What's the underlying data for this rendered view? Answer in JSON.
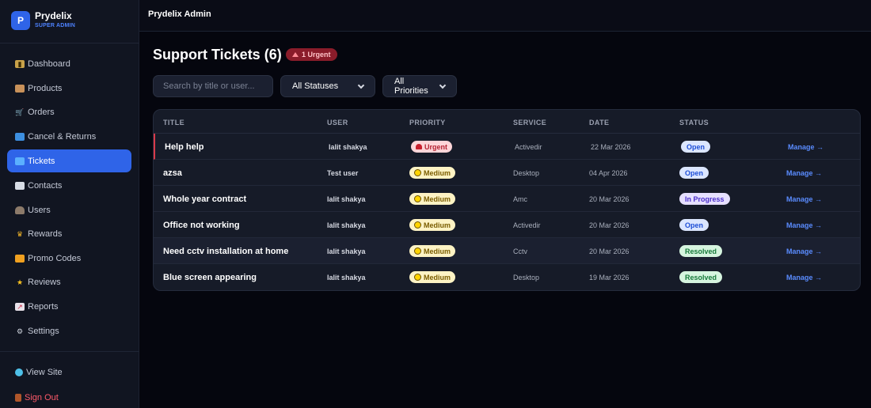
{
  "brand": {
    "logo": "P",
    "name": "Prydelix",
    "subtitle": "SUPER ADMIN"
  },
  "sidebar": {
    "items": [
      {
        "label": "Dashboard",
        "icon": "chart-icon",
        "active": false
      },
      {
        "label": "Products",
        "icon": "box-icon",
        "active": false
      },
      {
        "label": "Orders",
        "icon": "cart-icon",
        "active": false
      },
      {
        "label": "Cancel & Returns",
        "icon": "return-icon",
        "active": false
      },
      {
        "label": "Tickets",
        "icon": "ticket-icon",
        "active": true
      },
      {
        "label": "Contacts",
        "icon": "mailbox-icon",
        "active": false
      },
      {
        "label": "Users",
        "icon": "user-icon",
        "active": false
      },
      {
        "label": "Rewards",
        "icon": "trophy-icon",
        "active": false
      },
      {
        "label": "Promo Codes",
        "icon": "gift-icon",
        "active": false
      },
      {
        "label": "Reviews",
        "icon": "star-icon",
        "active": false
      },
      {
        "label": "Reports",
        "icon": "trend-icon",
        "active": false
      },
      {
        "label": "Settings",
        "icon": "gear-icon",
        "active": false
      }
    ],
    "footer": [
      {
        "label": "View Site",
        "icon": "globe-icon"
      },
      {
        "label": "Sign Out",
        "icon": "door-icon"
      }
    ]
  },
  "topbar": {
    "title": "Prydelix Admin"
  },
  "page": {
    "title": "Support Tickets (6)",
    "urgent_badge": "1 Urgent"
  },
  "filters": {
    "search_placeholder": "Search by title or user...",
    "status_value": "All Statuses",
    "priority_value": "All Priorities"
  },
  "table": {
    "columns": [
      "TITLE",
      "USER",
      "PRIORITY",
      "SERVICE",
      "DATE",
      "STATUS"
    ],
    "manage_label": "Manage →",
    "rows": [
      {
        "title": "Help help",
        "user": "lalit shakya",
        "priority": "Urgent",
        "service": "Activedir",
        "date": "22 Mar 2026",
        "status": "Open"
      },
      {
        "title": "azsa",
        "user": "Test user",
        "priority": "Medium",
        "service": "Desktop",
        "date": "04 Apr 2026",
        "status": "Open"
      },
      {
        "title": "Whole year contract",
        "user": "lalit shakya",
        "priority": "Medium",
        "service": "Amc",
        "date": "20 Mar 2026",
        "status": "In Progress"
      },
      {
        "title": "Office not working",
        "user": "lalit shakya",
        "priority": "Medium",
        "service": "Activedir",
        "date": "20 Mar 2026",
        "status": "Open"
      },
      {
        "title": "Need cctv installation at home",
        "user": "lalit shakya",
        "priority": "Medium",
        "service": "Cctv",
        "date": "20 Mar 2026",
        "status": "Resolved"
      },
      {
        "title": "Blue screen appearing",
        "user": "lalit shakya",
        "priority": "Medium",
        "service": "Desktop",
        "date": "19 Mar 2026",
        "status": "Resolved"
      }
    ]
  },
  "colors": {
    "accent": "#2f64e8",
    "background": "#05060e",
    "sidebar": "#111521",
    "danger": "#ff5a6a"
  }
}
